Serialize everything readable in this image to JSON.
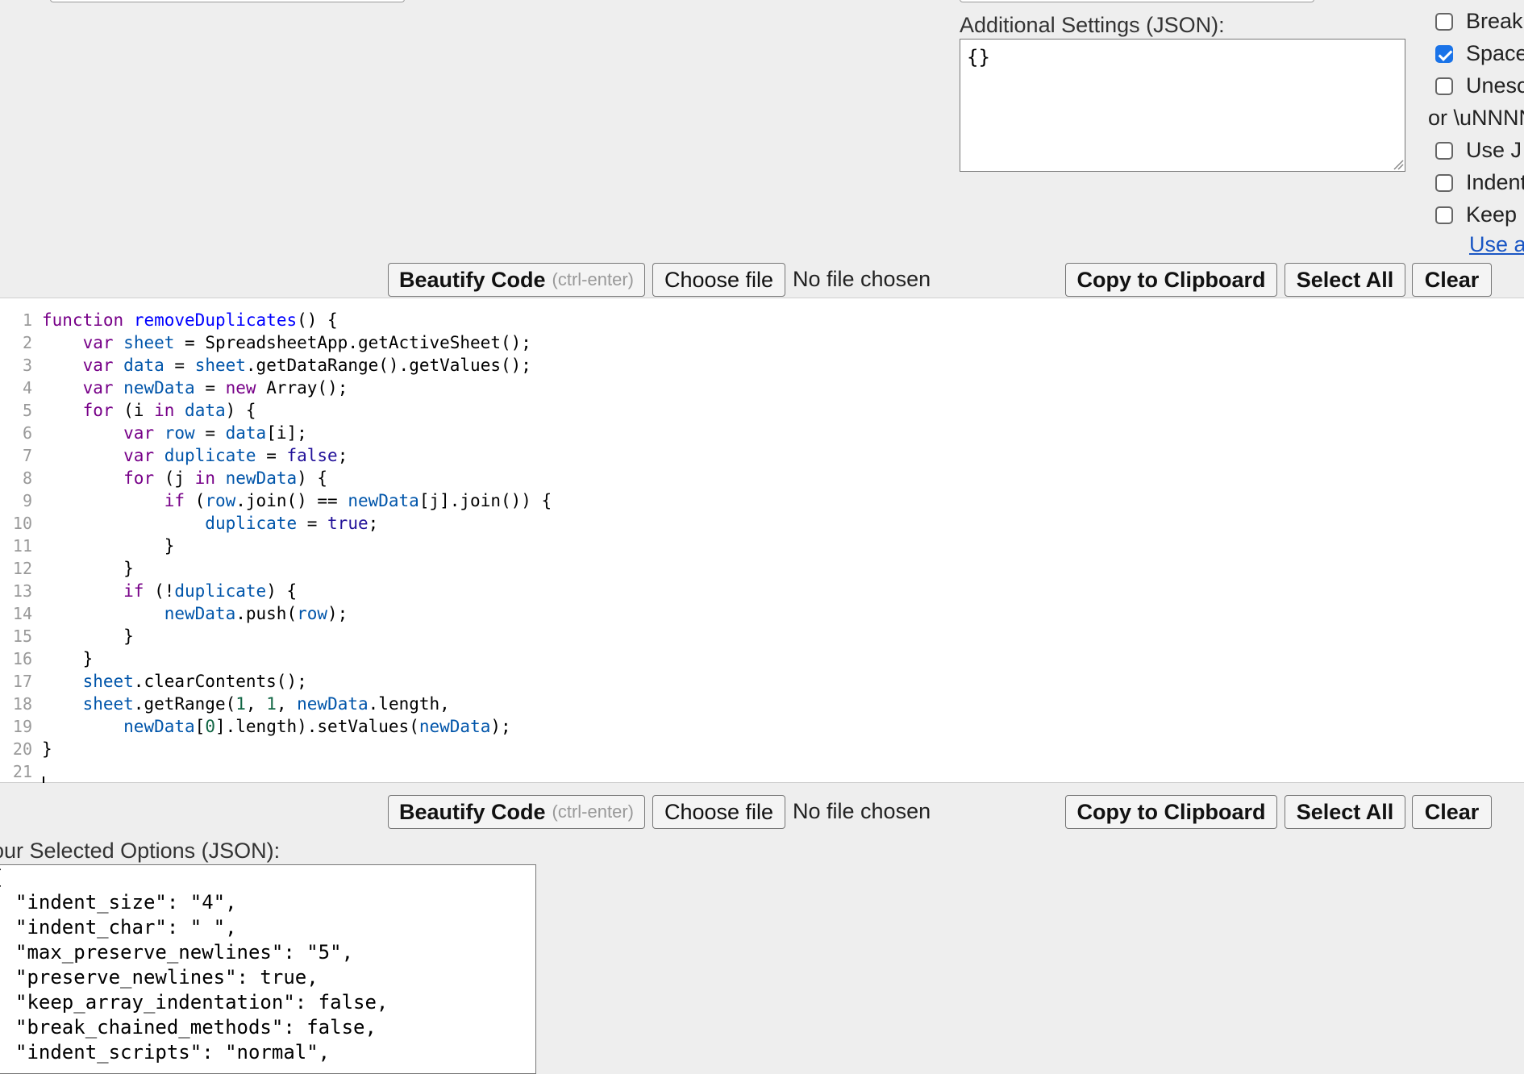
{
  "settings": {
    "label": "Additional Settings (JSON):",
    "value": "{}"
  },
  "options": [
    {
      "label": "Break",
      "checked": false
    },
    {
      "label": "Space",
      "checked": true
    },
    {
      "label": "Unesc",
      "checked": false
    },
    {
      "label": "or \\uNNNN",
      "plain": true
    },
    {
      "label": "Use J",
      "checked": false
    },
    {
      "label": "Indent",
      "checked": false
    },
    {
      "label": "Keep",
      "checked": false
    }
  ],
  "use_link": "Use a",
  "toolbar": {
    "beautify_label": "Beautify Code",
    "beautify_hint": "(ctrl-enter)",
    "choose_file_label": "Choose file",
    "no_file": "No file chosen",
    "copy_label": "Copy to Clipboard",
    "select_all_label": "Select All",
    "clear_label": "Clear"
  },
  "code_lines": [
    "function removeDuplicates() {",
    "    var sheet = SpreadsheetApp.getActiveSheet();",
    "    var data = sheet.getDataRange().getValues();",
    "    var newData = new Array();",
    "    for (i in data) {",
    "        var row = data[i];",
    "        var duplicate = false;",
    "        for (j in newData) {",
    "            if (row.join() == newData[j].join()) {",
    "                duplicate = true;",
    "            }",
    "        }",
    "        if (!duplicate) {",
    "            newData.push(row);",
    "        }",
    "    }",
    "    sheet.clearContents();",
    "    sheet.getRange(1, 1, newData.length,",
    "        newData[0].length).setValues(newData);",
    "}",
    ""
  ],
  "selected_options": {
    "label": "our Selected Options (JSON):",
    "lines": [
      "{",
      "\"indent_size\": \"4\",",
      "\"indent_char\": \" \",",
      "\"max_preserve_newlines\": \"5\",",
      "\"preserve_newlines\": true,",
      "\"keep_array_indentation\": false,",
      "\"break_chained_methods\": false,",
      "\"indent_scripts\": \"normal\","
    ]
  }
}
